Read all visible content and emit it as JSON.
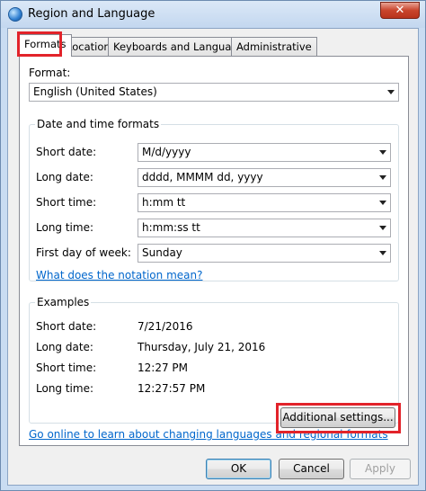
{
  "window": {
    "title": "Region and Language",
    "close_glyph": "✕"
  },
  "tabs": [
    {
      "label": "Formats",
      "active": true
    },
    {
      "label": "Location"
    },
    {
      "label": "Keyboards and Languages"
    },
    {
      "label": "Administrative"
    }
  ],
  "format": {
    "label": "Format:",
    "value": "English (United States)"
  },
  "date_time_formats": {
    "group_title": "Date and time formats",
    "rows": [
      {
        "label": "Short date:",
        "value": "M/d/yyyy"
      },
      {
        "label": "Long date:",
        "value": "dddd, MMMM dd, yyyy"
      },
      {
        "label": "Short time:",
        "value": "h:mm tt"
      },
      {
        "label": "Long time:",
        "value": "h:mm:ss tt"
      },
      {
        "label": "First day of week:",
        "value": "Sunday"
      }
    ],
    "notation_link": "What does the notation mean?"
  },
  "examples": {
    "group_title": "Examples",
    "rows": [
      {
        "label": "Short date:",
        "value": "7/21/2016"
      },
      {
        "label": "Long date:",
        "value": "Thursday, July 21, 2016"
      },
      {
        "label": "Short time:",
        "value": "12:27 PM"
      },
      {
        "label": "Long time:",
        "value": "12:27:57 PM"
      }
    ]
  },
  "additional_settings_label": "Additional settings...",
  "online_link": "Go online to learn about changing languages and regional formats",
  "buttons": {
    "ok": "OK",
    "cancel": "Cancel",
    "apply": "Apply"
  },
  "colors": {
    "highlight": "#e2232a",
    "link": "#0066cc"
  }
}
